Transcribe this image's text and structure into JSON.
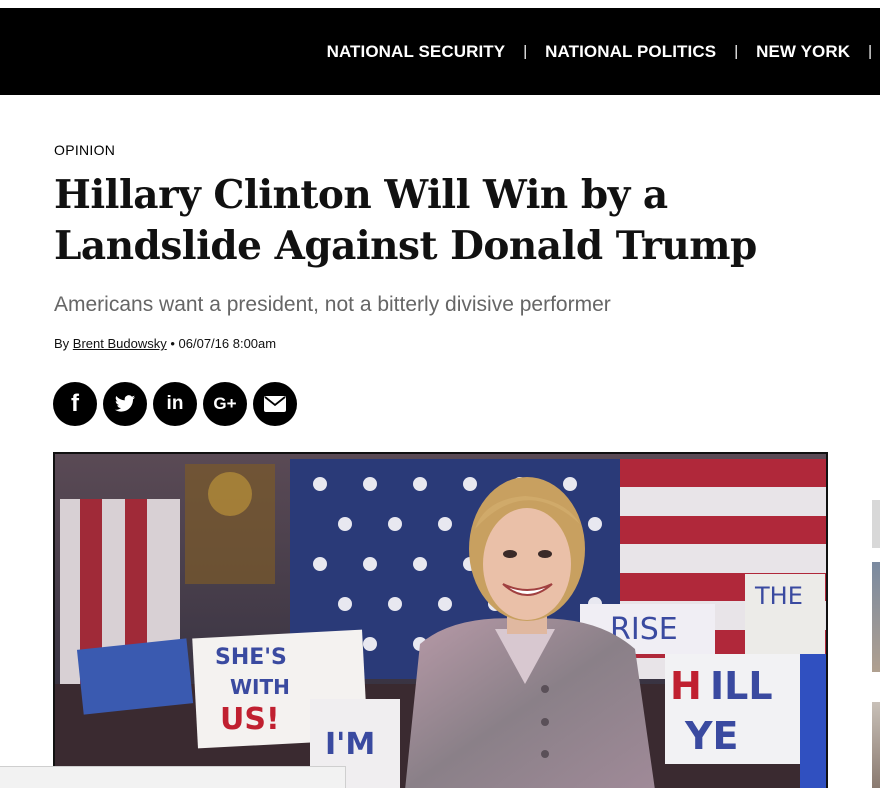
{
  "nav": {
    "items": [
      "NATIONAL SECURITY",
      "NATIONAL POLITICS",
      "NEW YORK"
    ],
    "separator": "|"
  },
  "article": {
    "kicker": "OPINION",
    "headline_line1": "Hillary Clinton Will Win by a",
    "headline_line2": "Landslide Against Donald Trump",
    "subhead": "Americans want a president, not a bitterly divisive performer",
    "byline_prefix": "By",
    "author": "Brent Budowsky",
    "dateline": "• 06/07/16 8:00am"
  },
  "share": {
    "buttons": [
      {
        "name": "facebook",
        "glyph": "f"
      },
      {
        "name": "twitter",
        "glyph": ""
      },
      {
        "name": "linkedin",
        "glyph": "in"
      },
      {
        "name": "google-plus",
        "glyph": "G+"
      },
      {
        "name": "email",
        "glyph": ""
      }
    ]
  },
  "hero_image": {
    "signs": [
      "SHE'S WITH US!",
      "I'M",
      "RISE",
      "THE",
      "HILL YE"
    ]
  },
  "colors": {
    "nav_bg": "#000000",
    "nav_text": "#ffffff",
    "headline": "#111111",
    "subhead": "#666666"
  }
}
